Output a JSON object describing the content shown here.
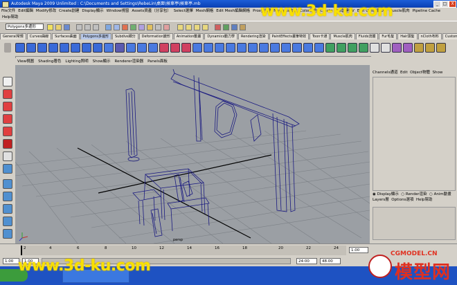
{
  "window": {
    "title": "Autodesk Maya 2009 Unlimited : C:\\Documents and Settings\\RebeLin\\桌面\\候車亭\\候車亭.mb",
    "minimize": "_",
    "maximize": "□",
    "close": "X"
  },
  "menubar": {
    "items": [
      "File文件",
      "Edit編輯",
      "Modify修改",
      "Create創建",
      "Display顯示",
      "Window視窗",
      "Assets資產（分享包）",
      "Select選擇",
      "Mesh網格",
      "Edit Mesh編輯網格",
      "Proxy代理",
      "Normals法線",
      "Color顏色",
      "Create UVs創建UV",
      "Edit UVs編輯UV",
      "Muscle肌肉",
      "Pipeline Cache"
    ],
    "help": "Help幫助"
  },
  "statusline": {
    "mode": "Polygons多邊形"
  },
  "shelf": {
    "tabs": [
      "General常規",
      "Curves曲線",
      "Surfaces曲面",
      "Polygons多邊形",
      "Subdivs細分",
      "Deformation變形",
      "Animation動畫",
      "Dynamics動力學",
      "Rendering渲染",
      "PaintEffects畫筆特效",
      "Toon卡通",
      "Muscle肌肉",
      "Fluids流體",
      "Fur毛髮",
      "Hair頭髮",
      "nCloth布料",
      "Custom自定義"
    ],
    "active_index": 3
  },
  "viewport": {
    "menu": [
      "View視圖",
      "Shading著色",
      "Lighting照明",
      "Show顯示",
      "Renderer渲染器",
      "Panels面板"
    ],
    "camera_label": "persp"
  },
  "channel_box": {
    "menu": [
      "Channels通道",
      "Edit",
      "Object物體",
      "Show"
    ]
  },
  "layer_editor": {
    "tabs": [
      "Display顯示",
      "Render渲染",
      "Anim動畫"
    ],
    "menu": [
      "Layers層",
      "Options選項",
      "Help幫助"
    ]
  },
  "timeline": {
    "ticks": [
      "2",
      "4",
      "6",
      "8",
      "10",
      "12",
      "14",
      "16",
      "18",
      "20",
      "22",
      "24"
    ],
    "current_frame": "1.00"
  },
  "range": {
    "start": "1.00",
    "start_inner": "1.00",
    "end_inner": "24:00",
    "end": "48.00"
  },
  "watermarks": {
    "top": "www.3d-ku.com",
    "bottom": "www.3d-ku.com",
    "cgmodel_url": "CGMODEL.CN",
    "cgmodel_text": "模型网"
  }
}
